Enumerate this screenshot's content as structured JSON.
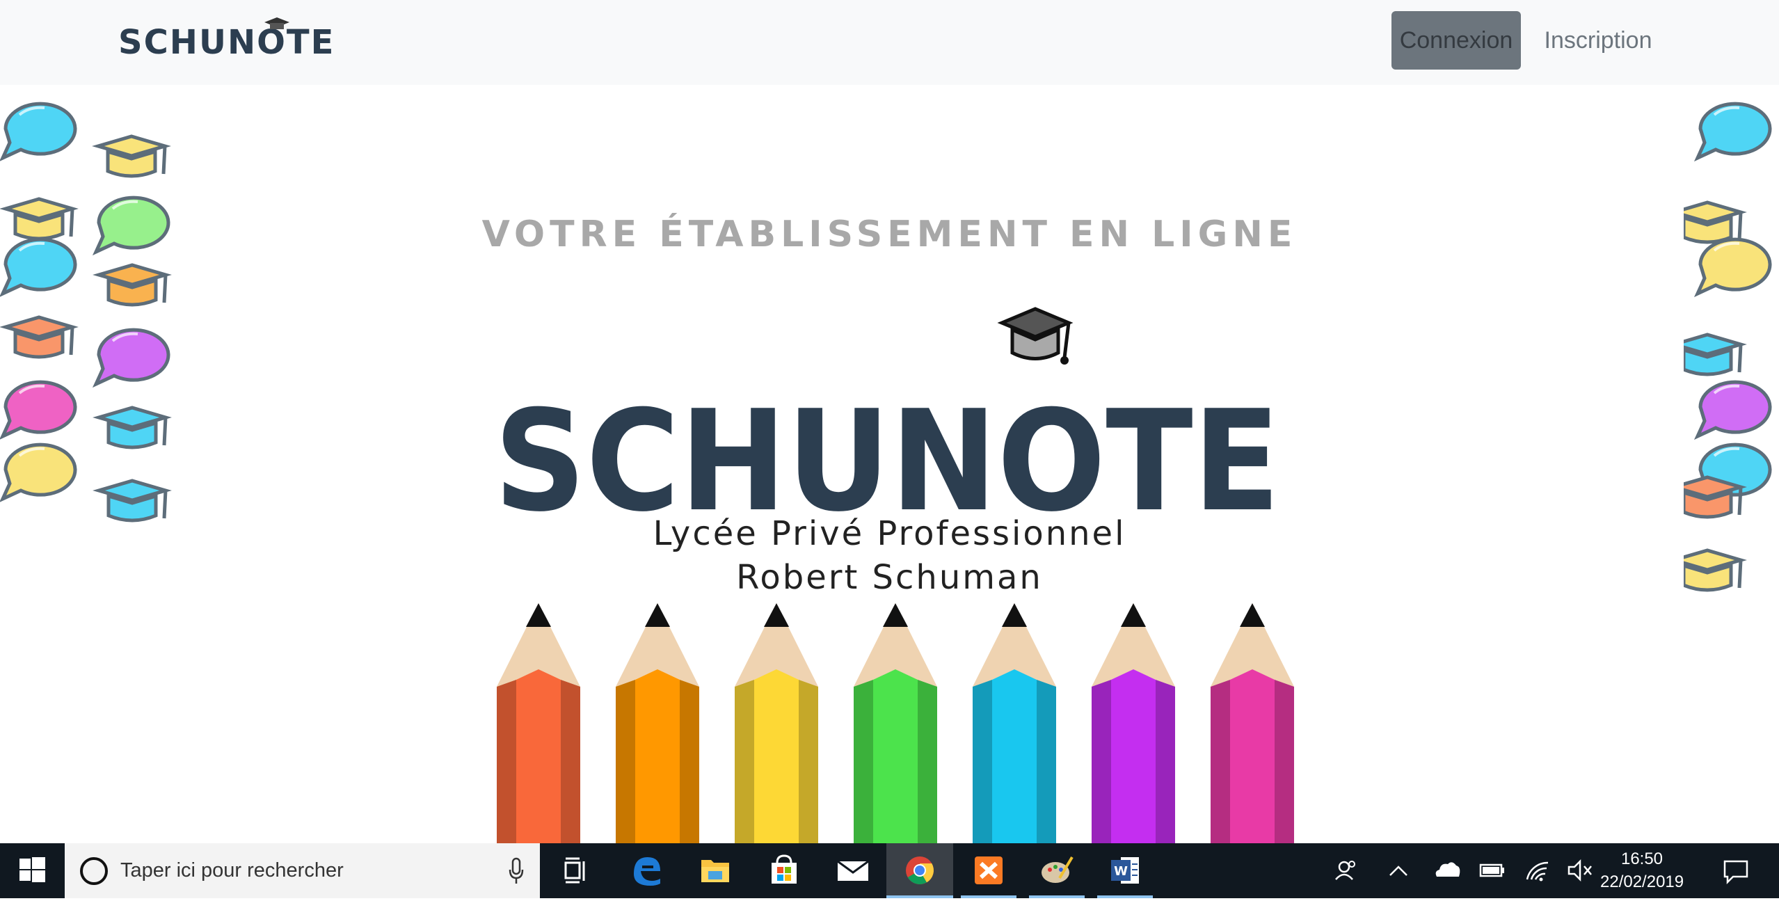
{
  "navbar": {
    "brand": "SCHUNOTE",
    "login_label": "Connexion",
    "register_label": "Inscription"
  },
  "hero": {
    "tagline": "VOTRE ÉTABLISSEMENT EN LIGNE",
    "logo_text": "SCHUNOTE",
    "school_line1": "Lycée Privé Professionnel",
    "school_line2": "Robert Schuman",
    "pencil_colors": [
      "#f9683a",
      "#ff9800",
      "#fdd835",
      "#4ce34c",
      "#19c7ef",
      "#c42ef0",
      "#e83aa6"
    ]
  },
  "taskbar": {
    "search_placeholder": "Taper ici pour rechercher",
    "time": "16:50",
    "date": "22/02/2019",
    "pinned": [
      "task-view-icon",
      "edge-icon",
      "file-explorer-icon",
      "store-icon",
      "mail-icon",
      "chrome-icon",
      "xampp-icon",
      "paint-icon",
      "word-icon"
    ],
    "tray": [
      "people-icon",
      "chevron-up-icon",
      "onedrive-icon",
      "battery-icon",
      "wifi-icon",
      "volume-muted-icon",
      "notifications-icon"
    ]
  },
  "colors": {
    "brand_dark": "#2c3e50",
    "navbar_bg": "#f8f9fa",
    "button_active": "#6c757d",
    "taskbar_bg": "#101820"
  }
}
